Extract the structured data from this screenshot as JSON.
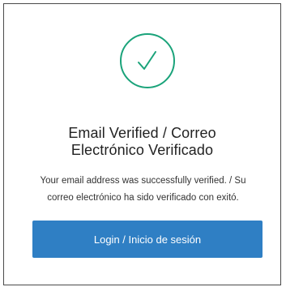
{
  "verification": {
    "title_line1": "Email Verified / Correo",
    "title_line2": "Electrónico Verificado",
    "message_line1": "Your email address was successfully verified. / Su",
    "message_line2": "correo electrónico ha sido verificado con exitó.",
    "button_label": "Login / Inicio de sesión"
  },
  "icons": {
    "status": "check-circle-icon"
  },
  "colors": {
    "success": "#1aa37a",
    "button": "#2f7fc4",
    "border": "#4a4a4a",
    "text": "#222222"
  }
}
